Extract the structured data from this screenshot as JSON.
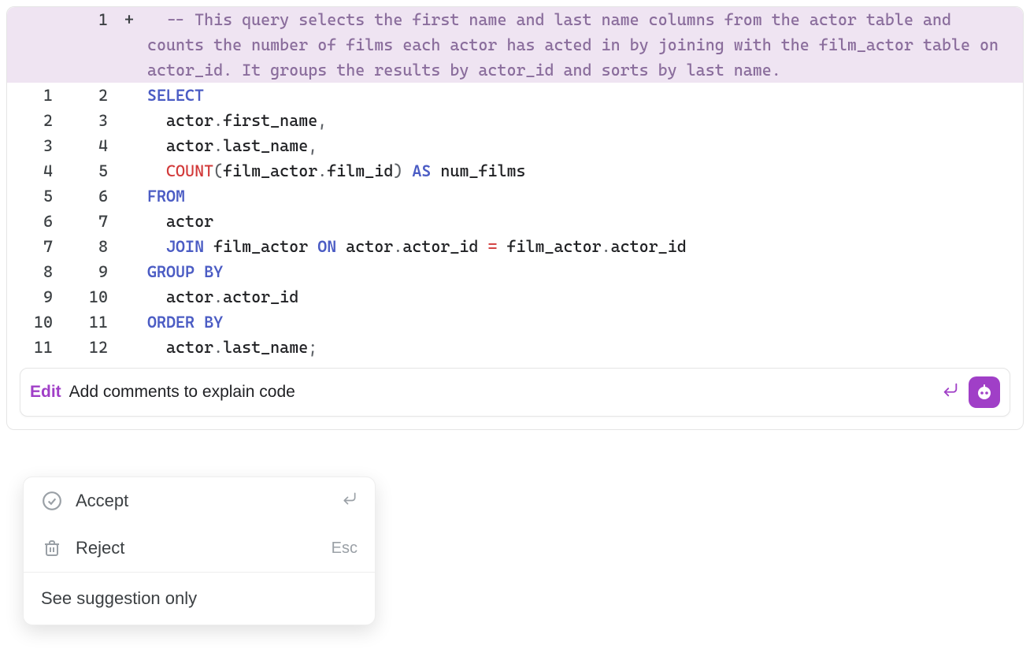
{
  "code": {
    "added_comment": "  -- This query selects the first name and last name columns from the actor table and counts the number of films each actor has acted in by joining with the film_actor table on actor_id. It groups the results by actor_id and sorts by last name.",
    "lines": [
      {
        "old": "",
        "new": "1",
        "marker": "+",
        "added": true,
        "tokens": [
          {
            "t": "  -- This query selects the first name and last name columns from the actor table and counts the number of films each actor has acted in by joining with the film_actor table on actor_id. It groups the results by actor_id and sorts by last name.",
            "c": "tok-comment"
          }
        ]
      },
      {
        "old": "1",
        "new": "2",
        "marker": "",
        "added": false,
        "tokens": [
          {
            "t": "SELECT",
            "c": "tok-keyword"
          }
        ]
      },
      {
        "old": "2",
        "new": "3",
        "marker": "",
        "added": false,
        "tokens": [
          {
            "t": "  actor",
            "c": "tok-ident"
          },
          {
            "t": ".",
            "c": "tok-punct"
          },
          {
            "t": "first_name",
            "c": "tok-ident"
          },
          {
            "t": ",",
            "c": "tok-punct"
          }
        ]
      },
      {
        "old": "3",
        "new": "4",
        "marker": "",
        "added": false,
        "tokens": [
          {
            "t": "  actor",
            "c": "tok-ident"
          },
          {
            "t": ".",
            "c": "tok-punct"
          },
          {
            "t": "last_name",
            "c": "tok-ident"
          },
          {
            "t": ",",
            "c": "tok-punct"
          }
        ]
      },
      {
        "old": "4",
        "new": "5",
        "marker": "",
        "added": false,
        "tokens": [
          {
            "t": "  ",
            "c": ""
          },
          {
            "t": "COUNT",
            "c": "tok-func"
          },
          {
            "t": "(",
            "c": "tok-punct"
          },
          {
            "t": "film_actor",
            "c": "tok-ident"
          },
          {
            "t": ".",
            "c": "tok-punct"
          },
          {
            "t": "film_id",
            "c": "tok-ident"
          },
          {
            "t": ")",
            "c": "tok-punct"
          },
          {
            "t": " ",
            "c": ""
          },
          {
            "t": "AS",
            "c": "tok-keyword"
          },
          {
            "t": " num_films",
            "c": "tok-ident"
          }
        ]
      },
      {
        "old": "5",
        "new": "6",
        "marker": "",
        "added": false,
        "tokens": [
          {
            "t": "FROM",
            "c": "tok-keyword"
          }
        ]
      },
      {
        "old": "6",
        "new": "7",
        "marker": "",
        "added": false,
        "tokens": [
          {
            "t": "  actor",
            "c": "tok-ident"
          }
        ]
      },
      {
        "old": "7",
        "new": "8",
        "marker": "",
        "added": false,
        "tokens": [
          {
            "t": "  ",
            "c": ""
          },
          {
            "t": "JOIN",
            "c": "tok-keyword"
          },
          {
            "t": " film_actor ",
            "c": "tok-ident"
          },
          {
            "t": "ON",
            "c": "tok-keyword"
          },
          {
            "t": " actor",
            "c": "tok-ident"
          },
          {
            "t": ".",
            "c": "tok-punct"
          },
          {
            "t": "actor_id ",
            "c": "tok-ident"
          },
          {
            "t": "=",
            "c": "tok-op"
          },
          {
            "t": " film_actor",
            "c": "tok-ident"
          },
          {
            "t": ".",
            "c": "tok-punct"
          },
          {
            "t": "actor_id",
            "c": "tok-ident"
          }
        ]
      },
      {
        "old": "8",
        "new": "9",
        "marker": "",
        "added": false,
        "tokens": [
          {
            "t": "GROUP BY",
            "c": "tok-keyword"
          }
        ]
      },
      {
        "old": "9",
        "new": "10",
        "marker": "",
        "added": false,
        "tokens": [
          {
            "t": "  actor",
            "c": "tok-ident"
          },
          {
            "t": ".",
            "c": "tok-punct"
          },
          {
            "t": "actor_id",
            "c": "tok-ident"
          }
        ]
      },
      {
        "old": "10",
        "new": "11",
        "marker": "",
        "added": false,
        "tokens": [
          {
            "t": "ORDER BY",
            "c": "tok-keyword"
          }
        ]
      },
      {
        "old": "11",
        "new": "12",
        "marker": "",
        "added": false,
        "tokens": [
          {
            "t": "  actor",
            "c": "tok-ident"
          },
          {
            "t": ".",
            "c": "tok-punct"
          },
          {
            "t": "last_name",
            "c": "tok-ident"
          },
          {
            "t": ";",
            "c": "tok-punct"
          }
        ]
      }
    ]
  },
  "edit_bar": {
    "label": "Edit",
    "text": "Add comments to explain code"
  },
  "menu": {
    "accept": {
      "label": "Accept",
      "shortcut": "↵"
    },
    "reject": {
      "label": "Reject",
      "shortcut": "Esc"
    },
    "suggestion_only": {
      "label": "See suggestion only"
    }
  }
}
